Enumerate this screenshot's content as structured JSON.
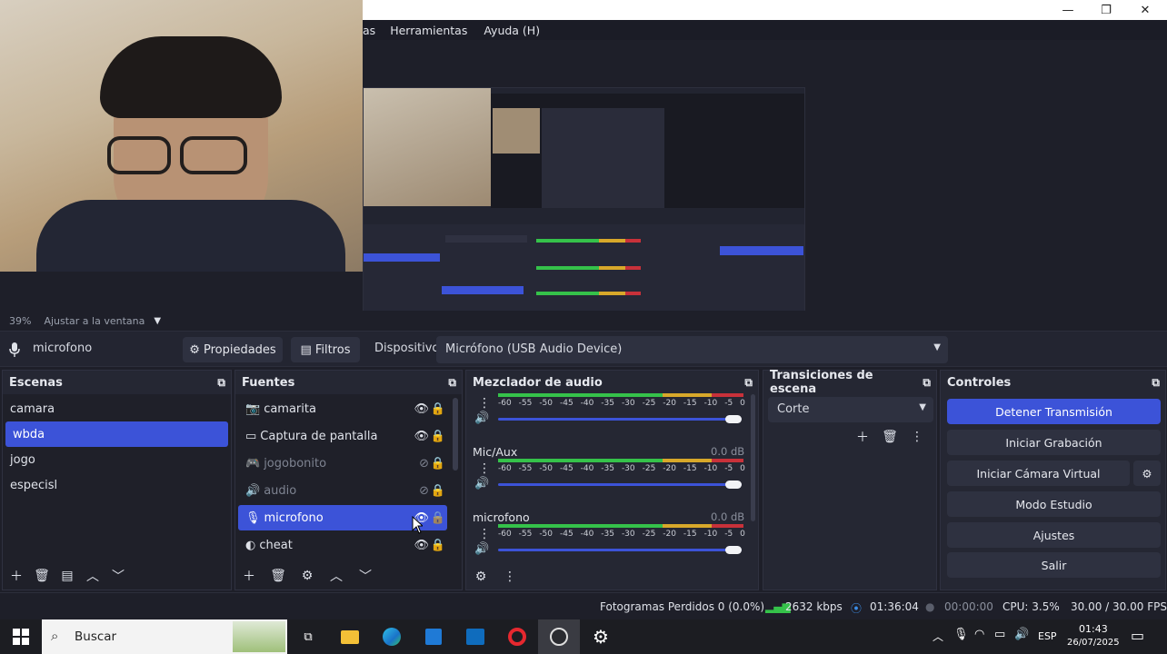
{
  "window": {
    "minimize_glyph": "—",
    "restore_glyph": "❐",
    "close_glyph": "✕"
  },
  "menu": {
    "items": [
      "as",
      "Herramientas",
      "Ayuda (H)"
    ]
  },
  "preview": {
    "zoom": "39%",
    "fit_label": "Ajustar a la ventana"
  },
  "source_toolbar": {
    "source_name": "microfono",
    "properties_label": "Propiedades",
    "filters_label": "Filtros",
    "device_label": "Dispositivo",
    "device_value": "Micrófono (USB Audio Device)"
  },
  "scenes": {
    "title": "Escenas",
    "items": [
      {
        "name": "camara",
        "selected": false
      },
      {
        "name": "wbda",
        "selected": true
      },
      {
        "name": "jogo",
        "selected": false
      },
      {
        "name": "especisl",
        "selected": false
      }
    ]
  },
  "sources": {
    "title": "Fuentes",
    "items": [
      {
        "name": "camarita",
        "icon": "camera-icon",
        "visible": true,
        "selected": false
      },
      {
        "name": "Captura de pantalla",
        "icon": "monitor-icon",
        "visible": true,
        "selected": false
      },
      {
        "name": "jogobonito",
        "icon": "gamepad-icon",
        "visible": false,
        "selected": false
      },
      {
        "name": "audio",
        "icon": "speaker-icon",
        "visible": false,
        "selected": false
      },
      {
        "name": "microfono",
        "icon": "microphone-icon",
        "visible": true,
        "selected": true
      },
      {
        "name": "cheat",
        "icon": "globe-icon",
        "visible": true,
        "selected": false
      }
    ]
  },
  "mixer": {
    "title": "Mezclador de audio",
    "scale": [
      "-60",
      "-55",
      "-50",
      "-45",
      "-40",
      "-35",
      "-30",
      "-25",
      "-20",
      "-15",
      "-10",
      "-5",
      "0"
    ],
    "channels": [
      {
        "name": "",
        "db": "",
        "volume": 1.0
      },
      {
        "name": "Mic/Aux",
        "db": "0.0 dB",
        "volume": 1.0
      },
      {
        "name": "microfono",
        "db": "0.0 dB",
        "volume": 1.0
      }
    ]
  },
  "transitions": {
    "title": "Transiciones de escena",
    "selected": "Corte"
  },
  "controls": {
    "title": "Controles",
    "buttons": [
      "Detener Transmisión",
      "Iniciar Grabación",
      "Iniciar Cámara Virtual",
      "Modo Estudio",
      "Ajustes",
      "Salir"
    ]
  },
  "status": {
    "dropped_frames": "Fotogramas Perdidos 0 (0.0%)",
    "bitrate": "2632 kbps",
    "stream_time": "01:36:04",
    "record_time": "00:00:00",
    "cpu": "CPU: 3.5%",
    "fps": "30.00 / 30.00 FPS"
  },
  "taskbar": {
    "search_placeholder": "Buscar",
    "lang": "ESP",
    "time": "01:43",
    "date": "26/07/2025"
  },
  "colors": {
    "accent": "#3c53d8",
    "meter_green": "#35c24a",
    "meter_yellow": "#d8a82a",
    "meter_red": "#c8313a"
  }
}
